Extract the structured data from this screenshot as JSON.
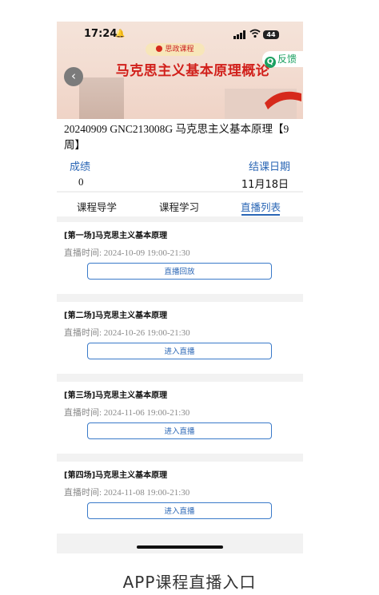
{
  "status_bar": {
    "time": "17:24",
    "battery": "44"
  },
  "banner": {
    "badge": "思政课程",
    "title": "马克思主义基本原理概论",
    "feedback_label": "反馈"
  },
  "course": {
    "name": "20240909 GNC213008G 马克思主义基本原理【9周】",
    "score_label": "成绩",
    "score_value": "0",
    "end_label": "结课日期",
    "end_value": "11月18日"
  },
  "tabs": [
    {
      "label": "课程导学"
    },
    {
      "label": "课程学习"
    },
    {
      "label": "直播列表"
    }
  ],
  "sessions": [
    {
      "title": "[第一场]马克思主义基本原理",
      "time": "直播时间: 2024-10-09 19:00-21:30",
      "button": "直播回放"
    },
    {
      "title": "[第二场]马克思主义基本原理",
      "time": "直播时间: 2024-10-26 19:00-21:30",
      "button": "进入直播"
    },
    {
      "title": "[第三场]马克思主义基本原理",
      "time": "直播时间: 2024-11-06 19:00-21:30",
      "button": "进入直播"
    },
    {
      "title": "[第四场]马克思主义基本原理",
      "time": "直播时间: 2024-11-08 19:00-21:30",
      "button": "进入直播"
    }
  ],
  "caption": "APP课程直播入口",
  "colors": {
    "accent": "#2a66b5",
    "title_red": "#d1201b",
    "feedback_green": "#1aa060"
  }
}
